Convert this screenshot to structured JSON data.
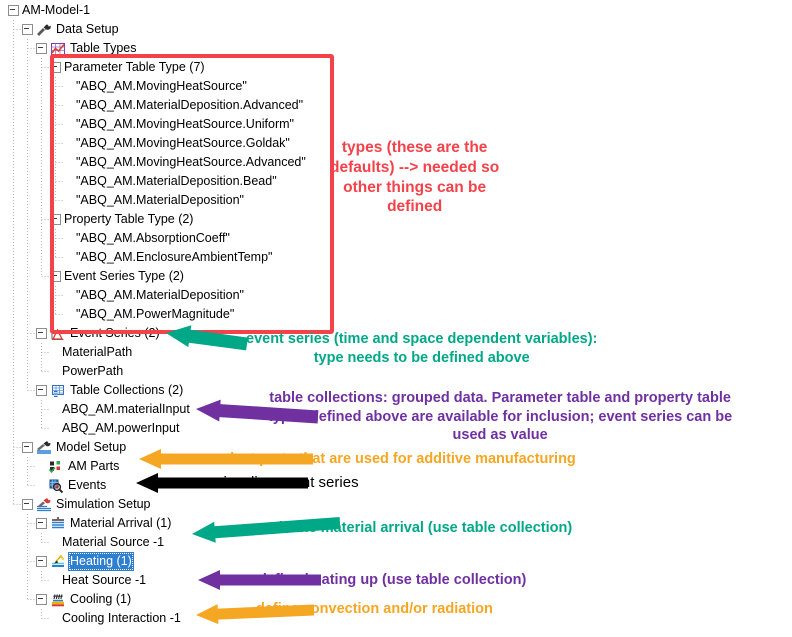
{
  "app": {
    "title": "AM-Model-1",
    "panel": "model-tree"
  },
  "colors": {
    "callout_red": "#f4424a",
    "annotation_red": "#f4424a",
    "annotation_teal": "#00a887",
    "annotation_purple": "#7030a0",
    "annotation_orange": "#f5a623",
    "annotation_black": "#000000",
    "selection_blue": "#2f7fd1",
    "tree_text": "#000000",
    "guide_line": "#b4b4b4"
  },
  "tree": {
    "root": "AM-Model-1",
    "nodes": [
      {
        "id": "am-model-1",
        "label": "AM-Model-1",
        "depth": 0,
        "expander": true,
        "icon": "none"
      },
      {
        "id": "data-setup",
        "label": "Data Setup",
        "depth": 1,
        "expander": true,
        "icon": "wrench-dark-icon"
      },
      {
        "id": "table-types",
        "label": "Table Types",
        "depth": 2,
        "expander": true,
        "icon": "table-chart-icon"
      },
      {
        "id": "parameter-table-type",
        "label": "Parameter Table Type (7)",
        "depth": 3,
        "expander": true,
        "icon": "none"
      },
      {
        "id": "pt-movingheatsource",
        "label": "\"ABQ_AM.MovingHeatSource\"",
        "depth": 4,
        "expander": false,
        "icon": "none"
      },
      {
        "id": "pt-materialdeposition-adv",
        "label": "\"ABQ_AM.MaterialDeposition.Advanced\"",
        "depth": 4,
        "expander": false,
        "icon": "none"
      },
      {
        "id": "pt-movingheatsource-uniform",
        "label": "\"ABQ_AM.MovingHeatSource.Uniform\"",
        "depth": 4,
        "expander": false,
        "icon": "none"
      },
      {
        "id": "pt-movingheatsource-goldak",
        "label": "\"ABQ_AM.MovingHeatSource.Goldak\"",
        "depth": 4,
        "expander": false,
        "icon": "none"
      },
      {
        "id": "pt-movingheatsource-adv",
        "label": "\"ABQ_AM.MovingHeatSource.Advanced\"",
        "depth": 4,
        "expander": false,
        "icon": "none"
      },
      {
        "id": "pt-materialdeposition-bead",
        "label": "\"ABQ_AM.MaterialDeposition.Bead\"",
        "depth": 4,
        "expander": false,
        "icon": "none"
      },
      {
        "id": "pt-materialdeposition",
        "label": "\"ABQ_AM.MaterialDeposition\"",
        "depth": 4,
        "expander": false,
        "icon": "none"
      },
      {
        "id": "property-table-type",
        "label": "Property Table Type (2)",
        "depth": 3,
        "expander": true,
        "icon": "none"
      },
      {
        "id": "prop-absorptioncoeff",
        "label": "\"ABQ_AM.AbsorptionCoeff\"",
        "depth": 4,
        "expander": false,
        "icon": "none"
      },
      {
        "id": "prop-enclosureambienttemp",
        "label": "\"ABQ_AM.EnclosureAmbientTemp\"",
        "depth": 4,
        "expander": false,
        "icon": "none"
      },
      {
        "id": "event-series-type",
        "label": "Event Series Type (2)",
        "depth": 3,
        "expander": true,
        "icon": "none"
      },
      {
        "id": "est-materialdeposition",
        "label": "\"ABQ_AM.MaterialDeposition\"",
        "depth": 4,
        "expander": false,
        "icon": "none"
      },
      {
        "id": "est-powermagnitude",
        "label": "\"ABQ_AM.PowerMagnitude\"",
        "depth": 4,
        "expander": false,
        "icon": "none"
      },
      {
        "id": "event-series",
        "label": "Event Series (2)",
        "depth": 2,
        "expander": true,
        "icon": "event-series-icon"
      },
      {
        "id": "materialpath",
        "label": "MaterialPath",
        "depth": 3,
        "expander": false,
        "icon": "none"
      },
      {
        "id": "powerpath",
        "label": "PowerPath",
        "depth": 3,
        "expander": false,
        "icon": "none"
      },
      {
        "id": "table-collections",
        "label": "Table Collections (2)",
        "depth": 2,
        "expander": true,
        "icon": "table-collection-icon"
      },
      {
        "id": "tc-materialinput",
        "label": "ABQ_AM.materialInput",
        "depth": 3,
        "expander": false,
        "icon": "none"
      },
      {
        "id": "tc-powerinput",
        "label": "ABQ_AM.powerInput",
        "depth": 3,
        "expander": false,
        "icon": "none"
      },
      {
        "id": "model-setup",
        "label": "Model Setup",
        "depth": 1,
        "expander": true,
        "icon": "wrench-blue-icon"
      },
      {
        "id": "am-parts",
        "label": "AM Parts",
        "depth": 2,
        "expander": false,
        "icon": "am-parts-icon"
      },
      {
        "id": "events",
        "label": "Events",
        "depth": 2,
        "expander": false,
        "icon": "events-magnifier-icon"
      },
      {
        "id": "simulation-setup",
        "label": "Simulation Setup",
        "depth": 1,
        "expander": true,
        "icon": "wrench-red-icon"
      },
      {
        "id": "material-arrival",
        "label": "Material Arrival (1)",
        "depth": 2,
        "expander": true,
        "icon": "material-arrival-icon"
      },
      {
        "id": "material-source-1",
        "label": "Material Source -1",
        "depth": 3,
        "expander": false,
        "icon": "none"
      },
      {
        "id": "heating",
        "label": "Heating (1)",
        "depth": 2,
        "expander": true,
        "icon": "heating-icon",
        "selected": true
      },
      {
        "id": "heat-source-1",
        "label": "Heat Source -1",
        "depth": 3,
        "expander": false,
        "icon": "none"
      },
      {
        "id": "cooling",
        "label": "Cooling (1)",
        "depth": 2,
        "expander": true,
        "icon": "cooling-icon"
      },
      {
        "id": "cooling-interaction-1",
        "label": "Cooling Interaction -1",
        "depth": 3,
        "expander": false,
        "icon": "none"
      }
    ]
  },
  "annotations": [
    {
      "id": "types-note",
      "color": "#f4424a",
      "align": "center",
      "lines": [
        "types (these are the",
        "defaults) --> needed so",
        "other things can be",
        "defined"
      ]
    },
    {
      "id": "event-series-note",
      "color": "#00a887",
      "align": "center",
      "lines": [
        "event series (time and space dependent variables):",
        "type needs to be defined above"
      ]
    },
    {
      "id": "table-collections-note",
      "color": "#7030a0",
      "align": "center",
      "lines": [
        "table collections: grouped data. Parameter table and property table",
        "types defined above are available for inclusion; event series can be",
        "used as value"
      ]
    },
    {
      "id": "am-parts-note",
      "color": "#f5a623",
      "align": "left",
      "lines": [
        "select parts that are used for additive manufacturing"
      ]
    },
    {
      "id": "events-note",
      "color": "#000000",
      "align": "left",
      "lines": [
        "visualize event series"
      ]
    },
    {
      "id": "material-arrival-note",
      "color": "#00a887",
      "align": "left",
      "lines": [
        "define material arrival (use table collection)"
      ]
    },
    {
      "id": "heating-note",
      "color": "#7030a0",
      "align": "left",
      "lines": [
        "define heating up (use table collection)"
      ]
    },
    {
      "id": "cooling-note",
      "color": "#f5a623",
      "align": "left",
      "lines": [
        "define convection and/or radiation"
      ]
    }
  ],
  "arrows": [
    {
      "id": "arrow-event-series",
      "color": "#00a887",
      "points": "from-annotation-to-tree"
    },
    {
      "id": "arrow-table-collections",
      "color": "#7030a0",
      "points": "from-annotation-to-tree"
    },
    {
      "id": "arrow-am-parts",
      "color": "#f5a623",
      "points": "from-annotation-to-tree"
    },
    {
      "id": "arrow-events",
      "color": "#000000",
      "points": "from-annotation-to-tree"
    },
    {
      "id": "arrow-material-arrival",
      "color": "#00a887",
      "points": "from-annotation-to-tree"
    },
    {
      "id": "arrow-heat-source",
      "color": "#7030a0",
      "points": "from-annotation-to-tree"
    },
    {
      "id": "arrow-cooling",
      "color": "#f5a623",
      "points": "from-annotation-to-tree"
    }
  ],
  "callout_box": {
    "id": "parameter-types-callout",
    "color": "#f4424a",
    "encloses": "Parameter Table Type (7) through \"ABQ_AM.PowerMagnitude\""
  }
}
